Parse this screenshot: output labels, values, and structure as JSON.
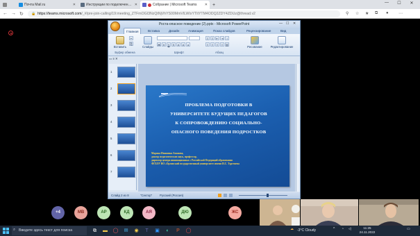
{
  "browser": {
    "tabs": [
      {
        "title": "Почта Mail.ru",
        "favicon_color": "#168de2"
      },
      {
        "title": "Инструкции по подключению - ",
        "favicon_color": "#5a6c80"
      },
      {
        "title": "Собрание | Microsoft Teams",
        "favicon_color": "#5b5fc7"
      }
    ],
    "url_host": "https://teams.microsoft.com",
    "url_path": "/_#/pre-join-calling/19:meeting_ZTFmOGI3NzQtNjVhYS00MmVlLWIxYTItYTM4ODQ2ZDY4ZDUz@thread.v2"
  },
  "powerpoint": {
    "title": "Роста-опасное поведение (2).pptx - Microsoft PowerPoint",
    "ribbon_tabs": [
      "Главная",
      "Вставка",
      "Дизайн",
      "Анимация",
      "Показ слайдов",
      "Рецензирование",
      "Вид"
    ],
    "ribbon": {
      "paste": "Вставить",
      "slides": "Слайды",
      "clipboard": "Буфер обмена",
      "font": "Шрифт",
      "paragraph": "Абзац",
      "drawing": "Рисование",
      "editing": "Редактирование"
    },
    "thumb_count": 7,
    "status": {
      "slide": "Слайд 2 из 8",
      "theme": "\"Сектор\"",
      "language": "Русский (Россия)"
    },
    "slide": {
      "title_lines": [
        "ПРОБЛЕМА ПОДГОТОВКИ В",
        "УНИВЕРСИТЕТЕ БУДУЩИХ ПЕДАГОГОВ",
        "К СОПРОВОЖДЕНИЮ СОЦИАЛЬНО-",
        "ОПАСНОГО ПОВЕДЕНИЯ ПОДРОСТКОВ"
      ],
      "author_lines": [
        "Марина Ивановна Аманова,",
        "доктор педагогических наук, профессор,",
        "директор центра инновационных с Российской Федераций образования",
        "ФГБОУ ВО «Орловский государственный университет имени И.С. Тургенева"
      ]
    }
  },
  "participants": [
    {
      "initials": "+4",
      "bg": "#6264a7",
      "fg": "#ffffff"
    },
    {
      "initials": "МВ",
      "bg": "#e8a39a",
      "fg": "#8a2a1e"
    },
    {
      "initials": "АР",
      "bg": "#bde5b5",
      "fg": "#2e6b25"
    },
    {
      "initials": "КД",
      "bg": "#bde5b5",
      "fg": "#2e6b25"
    },
    {
      "initials": "АЯ",
      "bg": "#f2b8c6",
      "fg": "#8a2442"
    },
    {
      "initials": "ДЮ",
      "bg": "#bde5b5",
      "fg": "#2e6b25"
    },
    {
      "initials": "ЖС",
      "bg": "#f4a9a0",
      "fg": "#9a2b20"
    }
  ],
  "taskbar": {
    "search_placeholder": "Введите здесь текст для поиска",
    "weather": "-3°C Cloudy",
    "time": "11:25",
    "date": "24.11.2022"
  }
}
